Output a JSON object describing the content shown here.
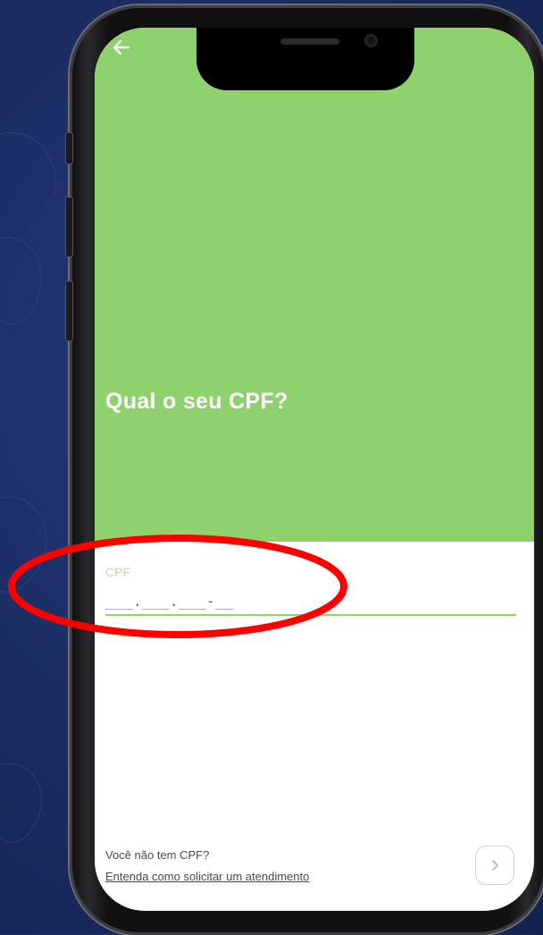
{
  "screen": {
    "title": "Qual o seu CPF?",
    "cpf_field": {
      "label": "CPF",
      "placeholder": "___.___.___-__",
      "value": ""
    },
    "footer": {
      "question": "Você não tem CPF?",
      "link": "Entenda como solicitar um atendimento"
    }
  },
  "colors": {
    "accent": "#8fd16d",
    "background": "#1b2d63",
    "annotation": "#ff0000"
  },
  "icons": {
    "back": "arrow-left",
    "next": "chevron-right"
  }
}
